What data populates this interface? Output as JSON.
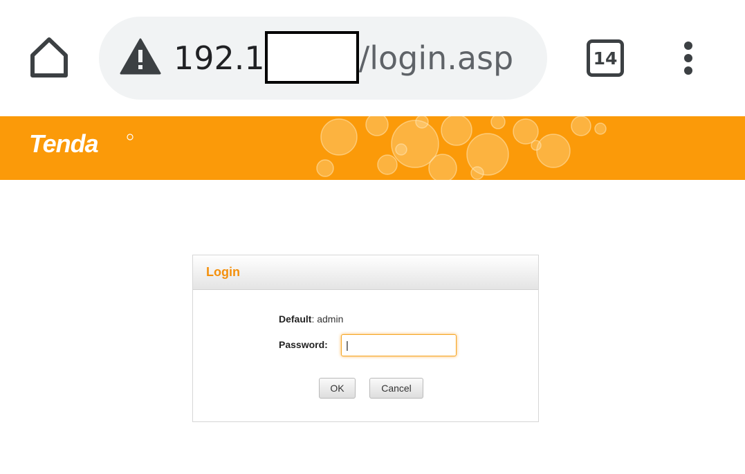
{
  "browser": {
    "url_host": "192.1",
    "url_path": "/login.asp",
    "tab_count": "14",
    "icons": {
      "home": "home-icon",
      "security_warning": "warning-icon",
      "tabs": "tab-switcher-icon",
      "menu": "more-vert-icon"
    }
  },
  "header": {
    "brand": "Tenda",
    "brand_color": "#fb9a09"
  },
  "login": {
    "title": "Login",
    "default_label": "Default",
    "default_value": ": admin",
    "password_label": "Password:",
    "password_value": "|",
    "ok_label": "OK",
    "cancel_label": "Cancel",
    "accent_color": "#f4900c"
  }
}
